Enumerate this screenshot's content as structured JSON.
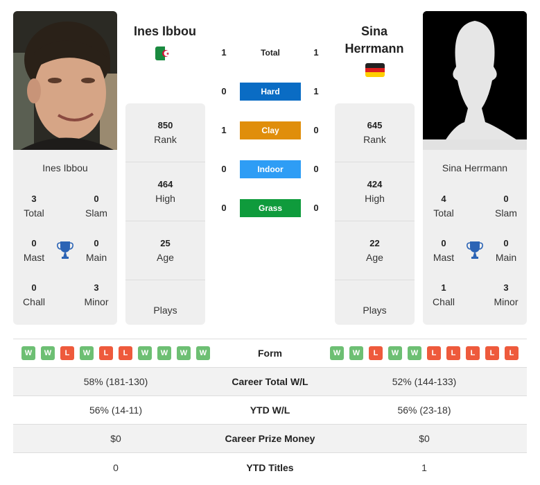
{
  "colors": {
    "hard": "#0a6cc4",
    "clay": "#e08e0b",
    "indoor": "#2e9df5",
    "grass": "#0f9b3c",
    "win": "#6dbf73",
    "loss": "#ee5a3c",
    "trophy": "#2c64b5"
  },
  "player1": {
    "name": "Ines Ibbou",
    "country_flag": "algeria-flag",
    "photo": "player-photo",
    "rank": "850",
    "rank_label": "Rank",
    "high": "464",
    "high_label": "High",
    "age": "25",
    "age_label": "Age",
    "plays_label": "Plays",
    "titles": {
      "total": "3",
      "total_label": "Total",
      "slam": "0",
      "slam_label": "Slam",
      "mast": "0",
      "mast_label": "Mast",
      "main": "0",
      "main_label": "Main",
      "chall": "0",
      "chall_label": "Chall",
      "minor": "3",
      "minor_label": "Minor"
    },
    "form": [
      "W",
      "W",
      "L",
      "W",
      "L",
      "L",
      "W",
      "W",
      "W",
      "W"
    ],
    "career_wl": "58% (181-130)",
    "ytd_wl": "56% (14-11)",
    "prize": "$0",
    "ytd_titles": "0"
  },
  "player2": {
    "name": "Sina Herrmann",
    "country_flag": "germany-flag",
    "photo": "silhouette-placeholder",
    "rank": "645",
    "rank_label": "Rank",
    "high": "424",
    "high_label": "High",
    "age": "22",
    "age_label": "Age",
    "plays_label": "Plays",
    "titles": {
      "total": "4",
      "total_label": "Total",
      "slam": "0",
      "slam_label": "Slam",
      "mast": "0",
      "mast_label": "Mast",
      "main": "0",
      "main_label": "Main",
      "chall": "1",
      "chall_label": "Chall",
      "minor": "3",
      "minor_label": "Minor"
    },
    "form": [
      "W",
      "W",
      "L",
      "W",
      "W",
      "L",
      "L",
      "L",
      "L",
      "L"
    ],
    "career_wl": "52% (144-133)",
    "ytd_wl": "56% (23-18)",
    "prize": "$0",
    "ytd_titles": "1"
  },
  "h2h": [
    {
      "label": "Total",
      "p1": "1",
      "p2": "1"
    },
    {
      "label": "Hard",
      "p1": "0",
      "p2": "1"
    },
    {
      "label": "Clay",
      "p1": "1",
      "p2": "0"
    },
    {
      "label": "Indoor",
      "p1": "0",
      "p2": "0"
    },
    {
      "label": "Grass",
      "p1": "0",
      "p2": "0"
    }
  ],
  "rows": {
    "form": "Form",
    "career_wl": "Career Total W/L",
    "ytd_wl": "YTD W/L",
    "prize": "Career Prize Money",
    "ytd_titles": "YTD Titles"
  }
}
